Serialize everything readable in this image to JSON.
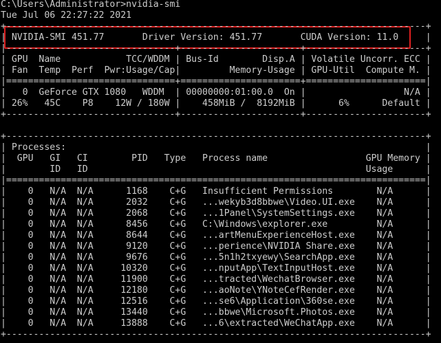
{
  "highlight_color": "#e02020",
  "terminal": {
    "lines": [
      "C:\\Users\\Administrator>nvidia-smi",
      "Tue Jul 06 22:27:22 2021",
      "+-----------------------------------------------------------------------------+",
      "| NVIDIA-SMI 451.77       Driver Version: 451.77       CUDA Version: 11.0     |",
      "|-------------------------------+----------------------+----------------------+",
      "| GPU  Name            TCC/WDDM | Bus-Id        Disp.A | Volatile Uncorr. ECC |",
      "| Fan  Temp  Perf  Pwr:Usage/Cap|         Memory-Usage | GPU-Util  Compute M. |",
      "|===============================+======================+======================|",
      "|   0  GeForce GTX 1080   WDDM  | 00000000:01:00.0  On |                  N/A |",
      "| 26%   45C    P8    12W / 180W |    458MiB /  8192MiB |      6%      Default |",
      "+-------------------------------+----------------------+----------------------+",
      "",
      "+-----------------------------------------------------------------------------+",
      "| Processes:                                                                  |",
      "|  GPU   GI   CI        PID   Type   Process name                  GPU Memory |",
      "|        ID   ID                                                   Usage      |",
      "|=============================================================================|",
      "|    0   N/A  N/A      1168    C+G   Insufficient Permissions        N/A      |",
      "|    0   N/A  N/A      2032    C+G   ...wekyb3d8bbwe\\Video.UI.exe    N/A      |",
      "|    0   N/A  N/A      2068    C+G   ...1Panel\\SystemSettings.exe    N/A      |",
      "|    0   N/A  N/A      8456    C+G   C:\\Windows\\explorer.exe         N/A      |",
      "|    0   N/A  N/A      8644    C+G   ...artMenuExperienceHost.exe    N/A      |",
      "|    0   N/A  N/A      9120    C+G   ...perience\\NVIDIA Share.exe    N/A      |",
      "|    0   N/A  N/A      9676    C+G   ...5n1h2txyewy\\SearchApp.exe    N/A      |",
      "|    0   N/A  N/A     10320    C+G   ...nputApp\\TextInputHost.exe    N/A      |",
      "|    0   N/A  N/A     11900    C+G   ...tracted\\WechatBrowser.exe    N/A      |",
      "|    0   N/A  N/A     12180    C+G   ...aoNote\\YNoteCefRender.exe    N/A      |",
      "|    0   N/A  N/A     12516    C+G   ...se6\\Application\\360se.exe    N/A      |",
      "|    0   N/A  N/A     13440    C+G   ...bbwe\\Microsoft.Photos.exe    N/A      |",
      "|    0   N/A  N/A     13888    C+G   ...6\\extracted\\WeChatApp.exe    N/A      |",
      "+-----------------------------------------------------------------------------+"
    ]
  }
}
